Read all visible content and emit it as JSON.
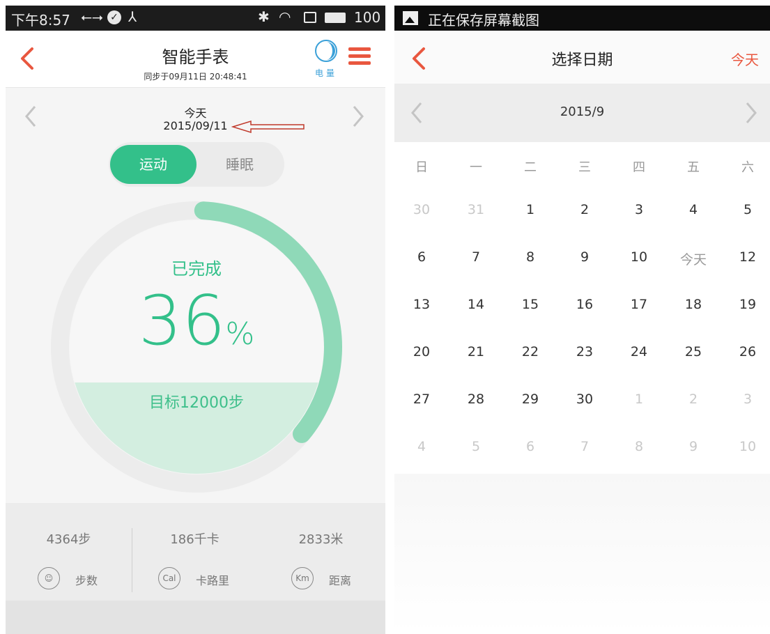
{
  "left": {
    "statusbar": {
      "time": "下午8:57",
      "battery": "100"
    },
    "header": {
      "title": "智能手表",
      "sync": "同步于09月11日 20:48:41",
      "battery_label": "电量"
    },
    "datebar": {
      "day": "今天",
      "date": "2015/09/11"
    },
    "toggle": {
      "active": "运动",
      "inactive": "睡眠"
    },
    "progress": {
      "label": "已完成",
      "value": "36",
      "unit": "%",
      "fraction": 0.36,
      "goal": "目标12000步"
    },
    "stats": [
      {
        "value": "4364步",
        "icon": "footprint-icon",
        "icon_text": "",
        "label": "步数"
      },
      {
        "value": "186千卡",
        "icon": "cal-icon",
        "icon_text": "Cal",
        "label": "卡路里"
      },
      {
        "value": "2833米",
        "icon": "km-icon",
        "icon_text": "Km",
        "label": "距离"
      }
    ],
    "colors": {
      "accent": "#33c08a",
      "accent_light": "#8fd9b8",
      "fill": "#d3eee0",
      "brand_red": "#e9573f"
    }
  },
  "right": {
    "statusbar": {
      "message": "正在保存屏幕截图"
    },
    "header": {
      "title": "选择日期",
      "today": "今天"
    },
    "month": "2015/9",
    "weekdays": [
      "日",
      "一",
      "二",
      "三",
      "四",
      "五",
      "六"
    ],
    "weeks": [
      [
        {
          "t": "30",
          "m": true
        },
        {
          "t": "31",
          "m": true
        },
        {
          "t": "1"
        },
        {
          "t": "2"
        },
        {
          "t": "3"
        },
        {
          "t": "4"
        },
        {
          "t": "5"
        }
      ],
      [
        {
          "t": "6"
        },
        {
          "t": "7"
        },
        {
          "t": "8"
        },
        {
          "t": "9"
        },
        {
          "t": "10"
        },
        {
          "t": "今天",
          "today": true
        },
        {
          "t": "12"
        }
      ],
      [
        {
          "t": "13"
        },
        {
          "t": "14"
        },
        {
          "t": "15"
        },
        {
          "t": "16"
        },
        {
          "t": "17"
        },
        {
          "t": "18"
        },
        {
          "t": "19"
        }
      ],
      [
        {
          "t": "20"
        },
        {
          "t": "21"
        },
        {
          "t": "22"
        },
        {
          "t": "23"
        },
        {
          "t": "24"
        },
        {
          "t": "25"
        },
        {
          "t": "26"
        }
      ],
      [
        {
          "t": "27"
        },
        {
          "t": "28"
        },
        {
          "t": "29"
        },
        {
          "t": "30"
        },
        {
          "t": "1",
          "m": true
        },
        {
          "t": "2",
          "m": true
        },
        {
          "t": "3",
          "m": true
        }
      ],
      [
        {
          "t": "4",
          "m": true
        },
        {
          "t": "5",
          "m": true
        },
        {
          "t": "6",
          "m": true
        },
        {
          "t": "7",
          "m": true
        },
        {
          "t": "8",
          "m": true
        },
        {
          "t": "9",
          "m": true
        },
        {
          "t": "10",
          "m": true
        }
      ]
    ]
  }
}
